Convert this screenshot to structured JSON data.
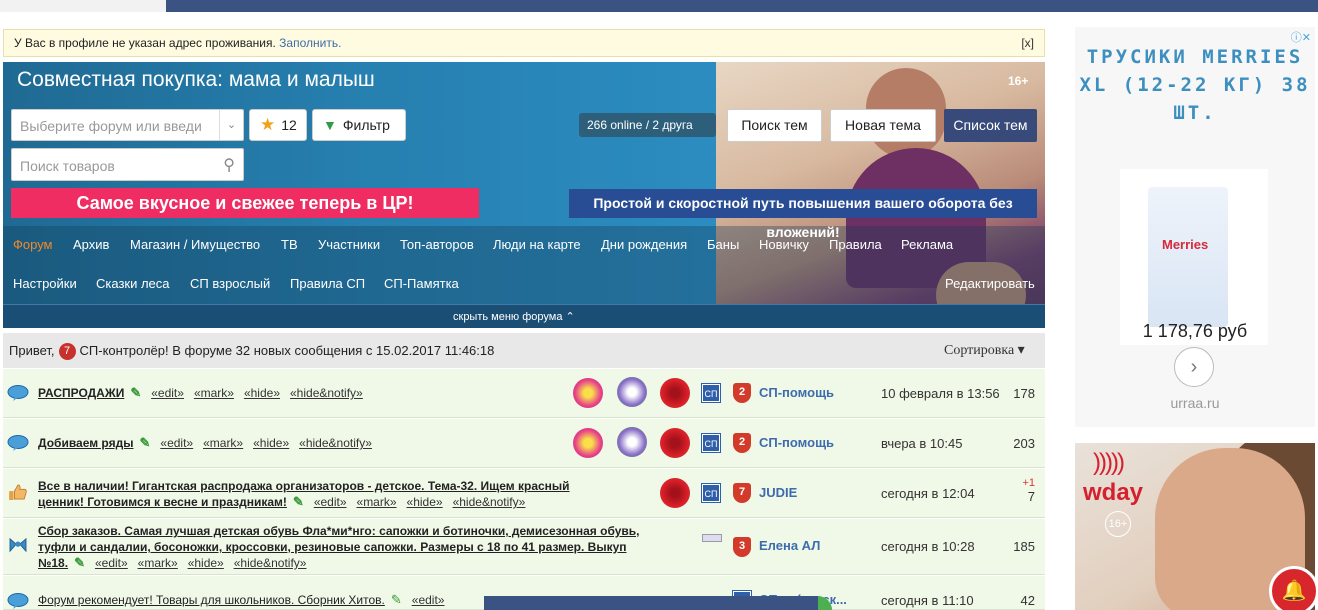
{
  "notice": {
    "text": "У Вас в профиле не указан адрес проживания.",
    "link": "Заполнить.",
    "close": "[x]"
  },
  "hero": {
    "title": "Совместная покупка: мама и малыш",
    "age": "16+",
    "forum_select_placeholder": "Выберите форум или введи",
    "fav_count": "12",
    "filter_label": "Фильтр",
    "search_placeholder": "Поиск товаров",
    "online_text": "266 online   / 2 друга",
    "btn_search_topics": "Поиск тем",
    "btn_new_topic": "Новая тема",
    "btn_topic_list": "Список тем",
    "promo_left": "Самое вкусное и свежее теперь в ЦР!",
    "promo_right": "Простой и скоростной путь повышения вашего оборота без вложений!",
    "hide_menu": "скрыть меню форума"
  },
  "nav1": [
    "Форум",
    "Архив",
    "Магазин / Имущество",
    "ТВ",
    "Участники",
    "Топ-авторов",
    "Люди на карте",
    "Дни рождения",
    "Баны",
    "Новичку",
    "Правила",
    "Реклама"
  ],
  "nav2": [
    "Настройки",
    "Сказки леса",
    "СП взрослый",
    "Правила СП",
    "СП-Памятка"
  ],
  "nav2_right": "Редактировать",
  "greeting": {
    "prefix": "Привет,",
    "badge": "7",
    "text": "СП-контролёр! В форуме 32 новых сообщения с 15.02.2017 11:46:18",
    "sort": "Сортировка ▾"
  },
  "links": {
    "edit": "«edit»",
    "mark": "«mark»",
    "hide": "«hide»",
    "hidenotify": "«hide&notify»"
  },
  "rows": [
    {
      "title": "РАСПРОДАЖИ",
      "user": "СП-помощь",
      "badge": "2",
      "date": "10 февраля в 13:56",
      "count": "178"
    },
    {
      "title": "Добиваем ряды",
      "user": "СП-помощь",
      "badge": "2",
      "date": "вчера в 10:45",
      "count": "203"
    },
    {
      "title_l1": "Все в наличии! Гигантская распродажа организаторов - детское. Тема-32. Ищем красный",
      "title_l2": "ценник! Готовимся к весне и праздникам!",
      "user": "JUDIE",
      "badge": "7",
      "date": "сегодня в 12:04",
      "plus": "+1",
      "count": "7"
    },
    {
      "title_l1": "Сбор заказов. Самая лучшая детская обувь Фла*ми*нго: сапожки и ботиночки, демисезонная обувь,",
      "title_l2": "туфли и сандалии, босоножки, кроссовки, резиновые сапожки. Размеры с 18 по 41 размер. Выкуп",
      "title_l3": "№18.",
      "user": "Елена АЛ",
      "badge": "3",
      "date": "сегодня в 10:28",
      "count": "185"
    },
    {
      "title": "Форум рекомендует! Товары для школьников. Сборник Хитов.",
      "user": "СП-... (детск...",
      "date": "сегодня в 11:10",
      "count": "42"
    }
  ],
  "sp_label": "СП",
  "ad1": {
    "title": "ТРУСИКИ MERRIES XL (12-22 КГ) 38 ШТ.",
    "brand": "Merries",
    "price": "1 178,76 руб",
    "domain": "urraa.ru"
  },
  "ad2": {
    "brand": "wday",
    "age": "16+"
  }
}
